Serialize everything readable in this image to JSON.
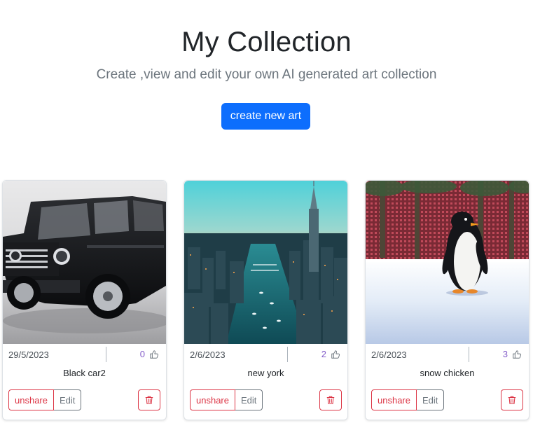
{
  "header": {
    "title": "My Collection",
    "subtitle": "Create ,view and edit your own AI generated art collection",
    "create_button": "create new art"
  },
  "cards": [
    {
      "date": "29/5/2023",
      "likes": "0",
      "name": "Black car2",
      "unshare_label": "unshare",
      "edit_label": "Edit",
      "image": "car-image"
    },
    {
      "date": "2/6/2023",
      "likes": "2",
      "name": "new york",
      "unshare_label": "unshare",
      "edit_label": "Edit",
      "image": "city-image"
    },
    {
      "date": "2/6/2023",
      "likes": "3",
      "name": "snow chicken",
      "unshare_label": "unshare",
      "edit_label": "Edit",
      "image": "penguin-image"
    }
  ],
  "colors": {
    "primary": "#0d6efd",
    "danger": "#dc3545",
    "secondary": "#6c757d",
    "likes": "#6f42c1"
  }
}
